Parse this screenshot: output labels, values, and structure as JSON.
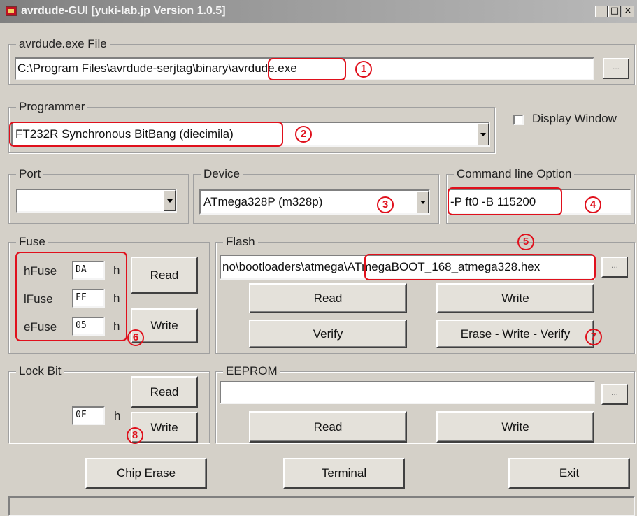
{
  "window": {
    "title": "avrdude-GUI [yuki-lab.jp Version 1.0.5]",
    "controls": {
      "minimize": "_",
      "maximize": "□",
      "close": "×"
    }
  },
  "avrdude_file": {
    "group_label": "avrdude.exe File",
    "path_prefix": "C:\\Program Files\\avrdude-serjtag\\binary\\",
    "path_exe": "avrdude.exe",
    "browse_label": "...",
    "marker": "1"
  },
  "programmer": {
    "group_label": "Programmer",
    "selected": "FT232R Synchronous BitBang (diecimila)",
    "marker": "2"
  },
  "display_window": {
    "label": "Display Window",
    "checked": false
  },
  "port": {
    "group_label": "Port",
    "selected": ""
  },
  "device": {
    "group_label": "Device",
    "selected": "ATmega328P (m328p)",
    "marker": "3"
  },
  "command_line": {
    "group_label": "Command line Option",
    "value": "-P ft0 -B 115200",
    "marker": "4"
  },
  "fuse": {
    "group_label": "Fuse",
    "rows": [
      {
        "label": "hFuse",
        "value": "DA",
        "suffix": "h"
      },
      {
        "label": "lFuse",
        "value": "FF",
        "suffix": "h"
      },
      {
        "label": "eFuse",
        "value": "05",
        "suffix": "h"
      }
    ],
    "read_label": "Read",
    "write_label": "Write",
    "marker": "6"
  },
  "flash": {
    "group_label": "Flash",
    "path_prefix": "no\\bootloaders\\atmega\\",
    "path_file": "ATmegaBOOT_168_atmega328.hex",
    "browse_label": "...",
    "read_label": "Read",
    "write_label": "Write",
    "verify_label": "Verify",
    "erase_write_verify_label": "Erase - Write - Verify",
    "marker_file": "5",
    "marker_erase": "7"
  },
  "lock_bit": {
    "group_label": "Lock Bit",
    "value": "0F",
    "suffix": "h",
    "read_label": "Read",
    "write_label": "Write",
    "marker": "8"
  },
  "eeprom": {
    "group_label": "EEPROM",
    "path": "",
    "browse_label": "...",
    "read_label": "Read",
    "write_label": "Write"
  },
  "footer": {
    "chip_erase_label": "Chip Erase",
    "terminal_label": "Terminal",
    "exit_label": "Exit"
  },
  "status_text": "",
  "colors": {
    "annotation_red": "#e0101c",
    "window_face": "#d4d0c8"
  }
}
